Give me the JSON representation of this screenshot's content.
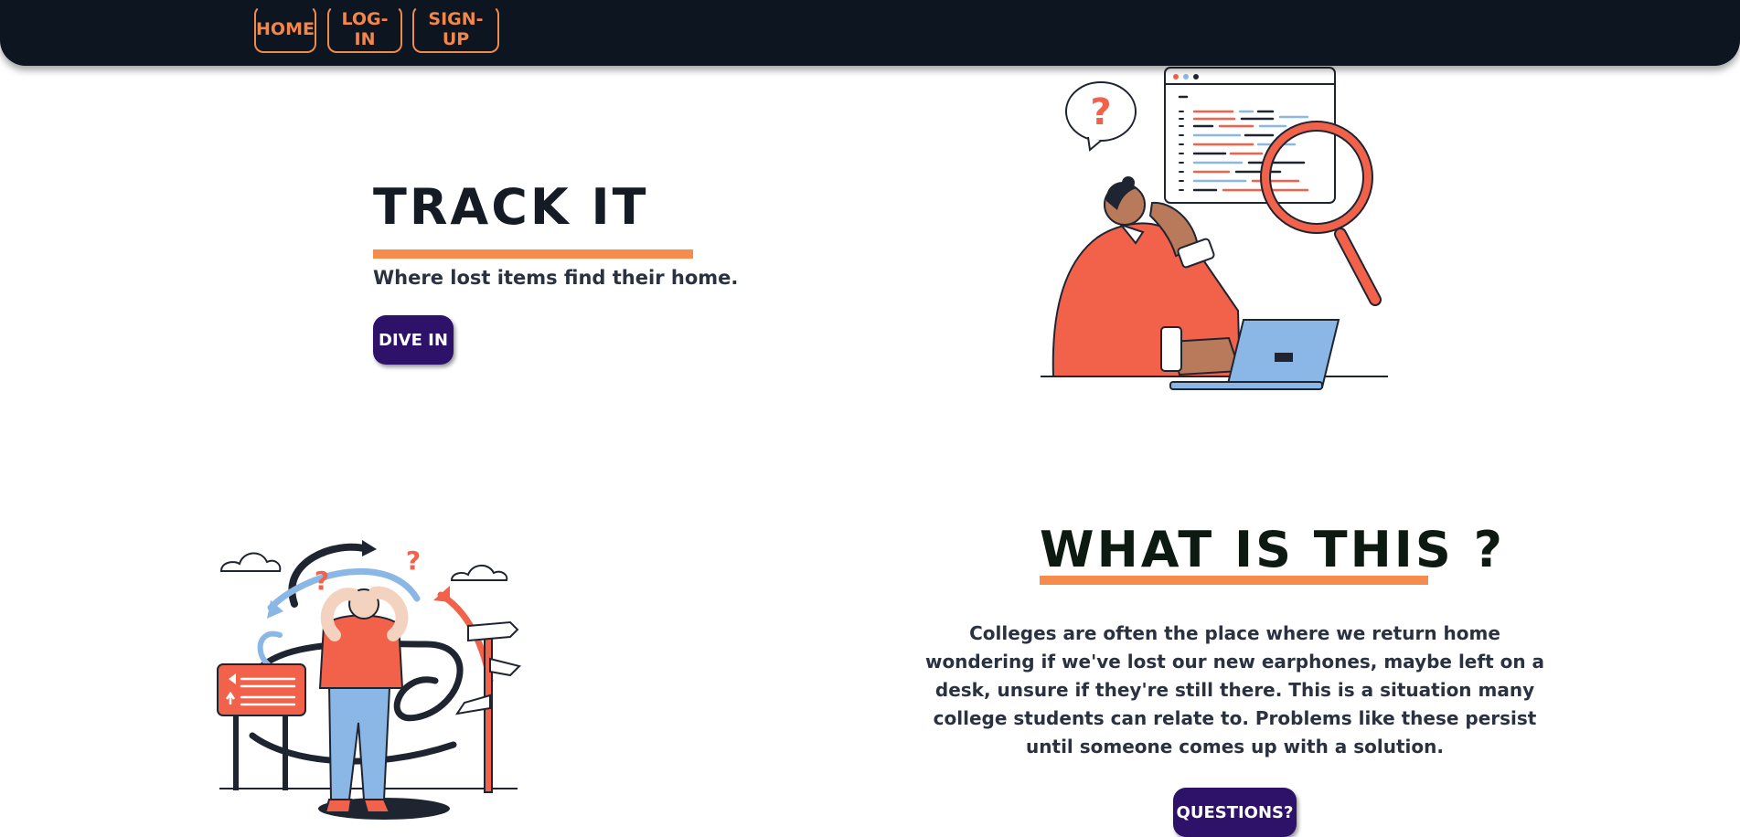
{
  "nav": {
    "home": "HOME",
    "login": "LOG-IN",
    "signup": "SIGN-UP"
  },
  "hero": {
    "title": "TRACK  IT",
    "tagline": "Where lost items find their home.",
    "cta": "DIVE IN"
  },
  "about": {
    "title": "WHAT IS THIS ?",
    "text": "Colleges are often the place where we return home wondering if we've lost our new earphones, maybe left on a desk, unsure if they're still there. This is a situation many college students can relate to. Problems like these persist until someone comes up with a solution.",
    "cta": "QUESTIONS?"
  },
  "colors": {
    "navbar": "#0d1520",
    "accent": "#f68c4b",
    "button": "#2e1269",
    "illustration_red": "#f2614a",
    "illustration_blue": "#8ab7e6"
  },
  "icons": [
    "question-bubble-icon",
    "magnifier-icon",
    "laptop-icon",
    "signpost-icon",
    "cloud-icon"
  ]
}
